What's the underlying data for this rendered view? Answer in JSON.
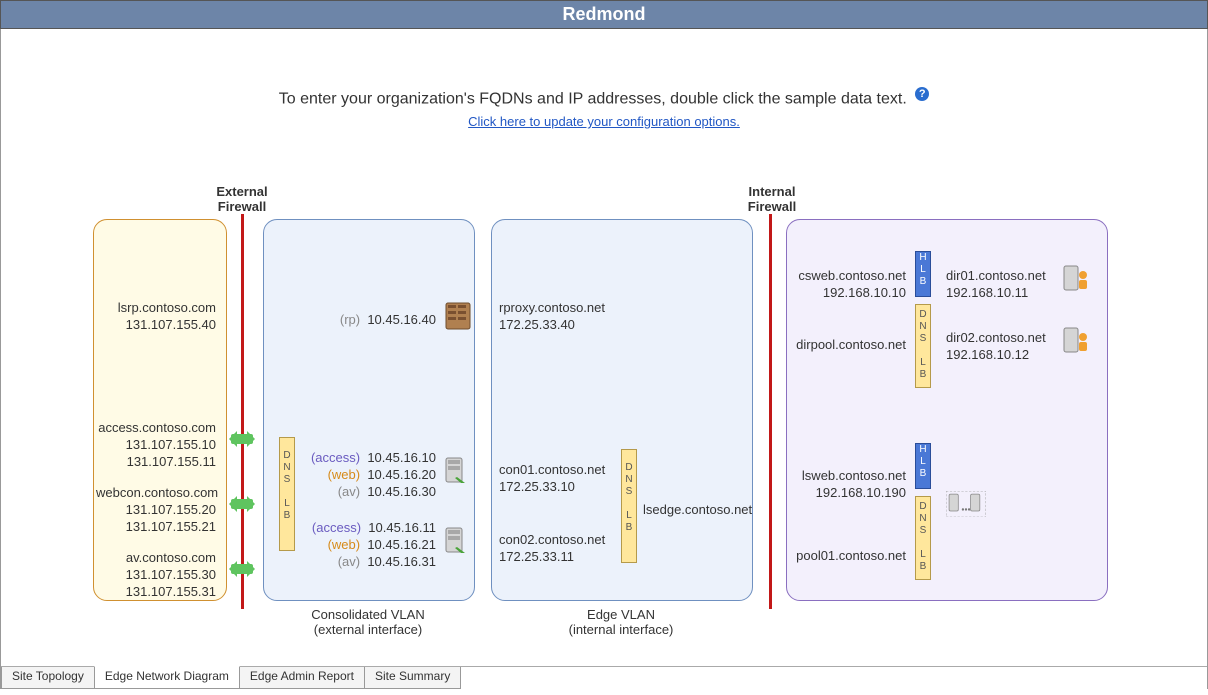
{
  "title": "Redmond",
  "instruction": "To enter your organization's FQDNs and IP addresses, double click the sample data text.",
  "config_link": "Click here to update your configuration options.",
  "firewalls": {
    "external": "External\nFirewall",
    "internal": "Internal\nFirewall"
  },
  "external": {
    "lsrp": {
      "host": "lsrp.contoso.com",
      "ip": "131.107.155.40"
    },
    "access": {
      "host": "access.contoso.com",
      "ip1": "131.107.155.10",
      "ip2": "131.107.155.11"
    },
    "webcon": {
      "host": "webcon.contoso.com",
      "ip1": "131.107.155.20",
      "ip2": "131.107.155.21"
    },
    "av": {
      "host": "av.contoso.com",
      "ip1": "131.107.155.30",
      "ip2": "131.107.155.31"
    }
  },
  "consolidated": {
    "caption_l1": "Consolidated VLAN",
    "caption_l2": "(external interface)",
    "rp": {
      "label": "(rp)",
      "ip": "10.45.16.40"
    },
    "slot1": {
      "acc": "10.45.16.10",
      "web": "10.45.16.20",
      "av": "10.45.16.30"
    },
    "slot2": {
      "acc": "10.45.16.11",
      "web": "10.45.16.21",
      "av": "10.45.16.31"
    },
    "lab_access": "(access)",
    "lab_web": "(web)",
    "lab_av": "(av)"
  },
  "edge": {
    "caption_l1": "Edge VLAN",
    "caption_l2": "(internal interface)",
    "rproxy": {
      "host": "rproxy.contoso.net",
      "ip": "172.25.33.40"
    },
    "con01": {
      "host": "con01.contoso.net",
      "ip": "172.25.33.10"
    },
    "con02": {
      "host": "con02.contoso.net",
      "ip": "172.25.33.11"
    },
    "lsedge": "lsedge.contoso.net"
  },
  "internal": {
    "csweb": {
      "host": "csweb.contoso.net",
      "ip": "192.168.10.10"
    },
    "dirpool": "dirpool.contoso.net",
    "dir01": {
      "host": "dir01.contoso.net",
      "ip": "192.168.10.11"
    },
    "dir02": {
      "host": "dir02.contoso.net",
      "ip": "192.168.10.12"
    },
    "lsweb": {
      "host": "lsweb.contoso.net",
      "ip": "192.168.10.190"
    },
    "pool01": "pool01.contoso.net"
  },
  "dns_lb_letters": [
    "D",
    "N",
    "S",
    "",
    "L",
    "B"
  ],
  "hlb_letters": [
    "H",
    "L",
    "B"
  ],
  "tabs": [
    "Site Topology",
    "Edge Network Diagram",
    "Edge Admin Report",
    "Site Summary"
  ],
  "active_tab": 1,
  "icon_names": {
    "rp": "reverse-proxy-server-icon",
    "srv": "server-icon",
    "dir": "directory-server-icon",
    "pool": "server-pool-icon",
    "help": "help-icon"
  }
}
